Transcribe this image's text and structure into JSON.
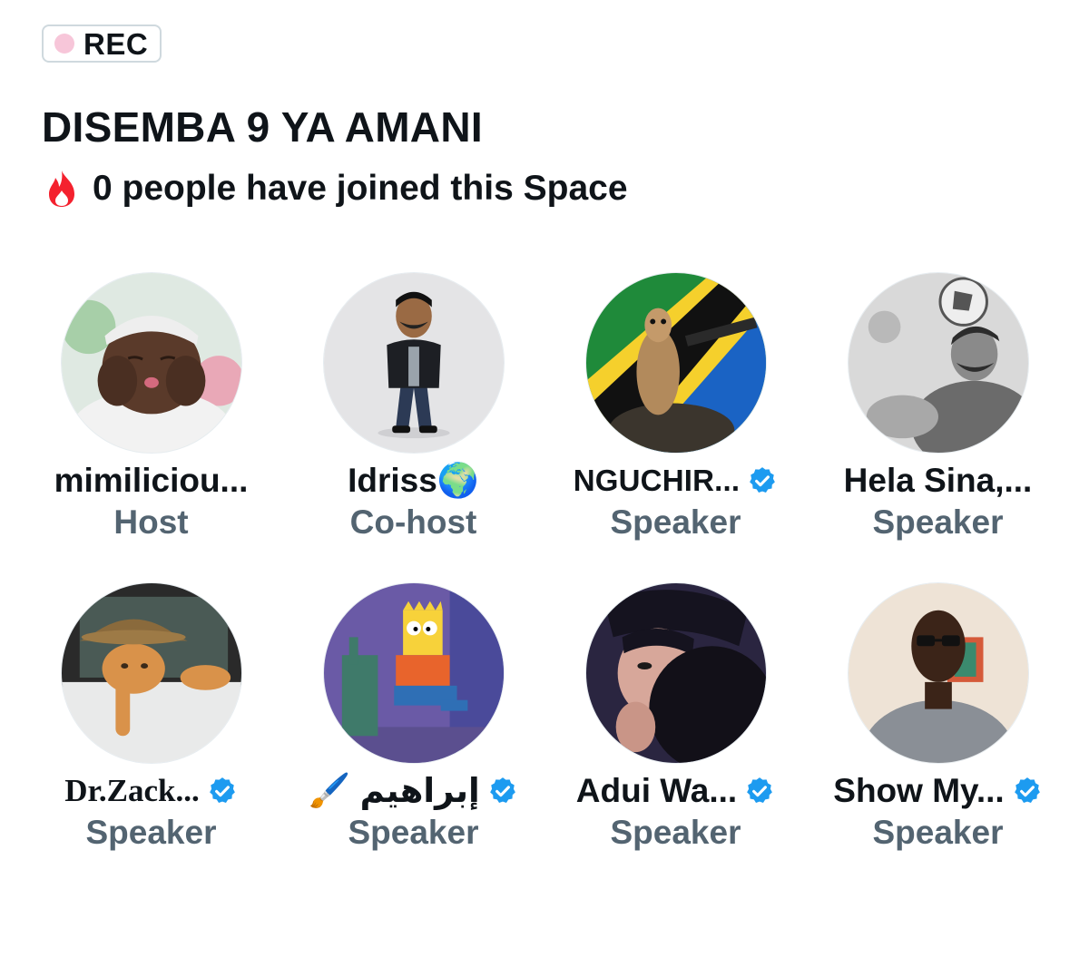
{
  "rec_badge": {
    "label": "REC"
  },
  "space": {
    "title": "DISEMBA 9 YA AMANI",
    "joined_text": "0 people have joined this Space"
  },
  "participants": [
    {
      "name": "mimiliciou...",
      "role": "Host",
      "verified": false,
      "avatar": "baby-avatar"
    },
    {
      "name": "Idriss🌍",
      "role": "Co-host",
      "verified": false,
      "avatar": "cartoon-man-avatar"
    },
    {
      "name": "NGUCHIR...",
      "role": "Speaker",
      "verified": true,
      "avatar": "meerkat-flag-avatar"
    },
    {
      "name": "Hela Sina,...",
      "role": "Speaker",
      "verified": false,
      "avatar": "footballer-avatar"
    },
    {
      "name": "Dr.Zack...",
      "role": "Speaker",
      "verified": true,
      "avatar": "cat-hat-avatar"
    },
    {
      "name": "إبراهيم 🖌️",
      "role": "Speaker",
      "verified": true,
      "avatar": "bart-avatar"
    },
    {
      "name": "Adui Wa...",
      "role": "Speaker",
      "verified": true,
      "avatar": "anime-avatar"
    },
    {
      "name": "Show My...",
      "role": "Speaker",
      "verified": true,
      "avatar": "man-glasses-avatar"
    }
  ],
  "colors": {
    "verified": "#1d9bf0",
    "role_text": "#536471",
    "rec_dot": "#f7c6d9",
    "fire": "#f4212e"
  }
}
